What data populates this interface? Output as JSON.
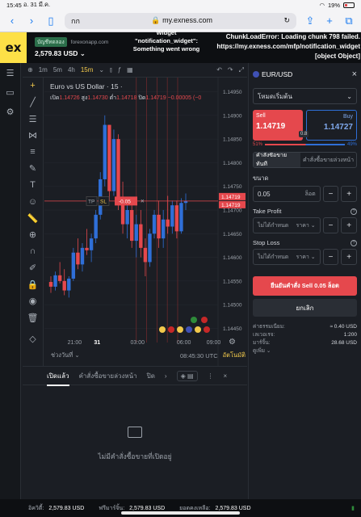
{
  "status": {
    "time": "15:45",
    "date": "อ. 31 มี.ค.",
    "battery": "19%"
  },
  "browser": {
    "back_icon": "chevron-left-icon",
    "forward_icon": "chevron-right-icon",
    "tab_text": "กก",
    "url": "my.exness.com"
  },
  "header": {
    "account_badge": "บัญชีทดลอง",
    "account_host": "forexonapp.com",
    "balance": "2,579.83 USD",
    "error_widget": "Widget \"notification_widget\": Something went wrong",
    "error_chunk": "ChunkLoadError: Loading chunk 798 failed. https://my.exness.com/mfp/notification_widget [object Object]"
  },
  "toolbar": {
    "timeframes": [
      "1m",
      "5m",
      "4h",
      "15m"
    ],
    "active_timeframe": "15m"
  },
  "chart_data": {
    "type": "candlestick",
    "title": "Euro vs US Dollar · 15 ·",
    "ohlc_label": {
      "o": "1.14726",
      "h": "1.14730",
      "l": "1.14718",
      "c": "1.14719",
      "chg": "−0.00005 (−0"
    },
    "labels_prefix": {
      "o": "เปิด",
      "h": "สูง",
      "l": "ต่ำ",
      "c": "ปิด"
    },
    "y_ticks": [
      "1.14950",
      "1.14900",
      "1.14850",
      "1.14800",
      "1.14750",
      "1.14700",
      "1.14650",
      "1.14600",
      "1.14550",
      "1.14500",
      "1.14450"
    ],
    "y_range": [
      1.1442,
      1.1498
    ],
    "x_ticks": [
      "21:00",
      "31",
      "03:00",
      "06:00",
      "09:00"
    ],
    "price_label": "1.14719",
    "price_label2": "1.14719",
    "position_bar": {
      "tp": "TP",
      "sl": "SL",
      "pnl": "-0.05"
    },
    "candles": [
      [
        1.14548,
        1.1456,
        1.14525,
        1.14538
      ],
      [
        1.14538,
        1.1457,
        1.1453,
        1.14562
      ],
      [
        1.14562,
        1.1459,
        1.14545,
        1.1455
      ],
      [
        1.1455,
        1.14575,
        1.1452,
        1.1453
      ],
      [
        1.1453,
        1.1456,
        1.14515,
        1.14555
      ],
      [
        1.14555,
        1.1462,
        1.1455,
        1.1461
      ],
      [
        1.1461,
        1.1464,
        1.14575,
        1.14585
      ],
      [
        1.14585,
        1.1463,
        1.1457,
        1.1462
      ],
      [
        1.1462,
        1.1466,
        1.14605,
        1.14615
      ],
      [
        1.14615,
        1.1465,
        1.1459,
        1.1464
      ],
      [
        1.1464,
        1.147,
        1.1463,
        1.1469
      ],
      [
        1.1469,
        1.1478,
        1.1468,
        1.14765
      ],
      [
        1.14765,
        1.149,
        1.1475,
        1.1488
      ],
      [
        1.1488,
        1.1488,
        1.1472,
        1.1474
      ],
      [
        1.1474,
        1.1487,
        1.1473,
        1.1485
      ],
      [
        1.1485,
        1.1486,
        1.147,
        1.1472
      ],
      [
        1.1472,
        1.1476,
        1.1465,
        1.1467
      ],
      [
        1.1467,
        1.1472,
        1.1464,
        1.147
      ],
      [
        1.147,
        1.1471,
        1.1462,
        1.14635
      ],
      [
        1.14635,
        1.1469,
        1.146,
        1.1467
      ],
      [
        1.1467,
        1.147,
        1.146,
        1.1462
      ],
      [
        1.1462,
        1.1464,
        1.1456,
        1.1459
      ],
      [
        1.1459,
        1.1466,
        1.1458,
        1.1465
      ],
      [
        1.1465,
        1.147,
        1.1464,
        1.1469
      ],
      [
        1.1469,
        1.1472,
        1.1462,
        1.1464
      ],
      [
        1.1464,
        1.147,
        1.1462,
        1.1468
      ],
      [
        1.1468,
        1.1473,
        1.1465,
        1.14665
      ],
      [
        1.14665,
        1.1472,
        1.1465,
        1.1471
      ],
      [
        1.1471,
        1.1472,
        1.1464,
        1.14655
      ],
      [
        1.14655,
        1.14725,
        1.1465,
        1.14715
      ],
      [
        1.14715,
        1.14735,
        1.147,
        1.14719
      ]
    ]
  },
  "range_bar": {
    "range_label": "ช่วงวันที่",
    "time": "08:45:30 UTC",
    "auto": "อัตโนมัติ"
  },
  "orders": {
    "tabs": [
      "เปิดแล้ว",
      "คำสั่งซื้อขายล่วงหน้า",
      "ปิด"
    ],
    "empty_text": "ไม่มีคำสั่งซื้อขายที่เปิดอยู่"
  },
  "side": {
    "symbol": "EUR/USD",
    "mode": "โหมดเริ่มต้น",
    "sell_label": "Sell",
    "sell_price": "1.14719",
    "spread": "0.8",
    "buy_label": "Buy",
    "buy_price": "1.14727",
    "pct_sell": "51%",
    "pct_buy": "49%",
    "order_tab_market": "คำสั่งซื้อขายทันที",
    "order_tab_pending": "คำสั่งซื้อขายล่วงหน้า",
    "volume_label": "ขนาด",
    "volume": "0.05",
    "volume_unit": "ล็อต",
    "tp_label": "Take Profit",
    "tp_value": "ไม่ได้กำหนด",
    "tp_unit": "ราคา",
    "sl_label": "Stop Loss",
    "sl_value": "ไม่ได้กำหนด",
    "sl_unit": "ราคา",
    "confirm": "ยืนยันคำสั่ง Sell 0.05 ล็อต",
    "cancel": "ยกเลิก",
    "fee_label": "ค่าธรรมเนียม:",
    "fee_value": "≈ 0.40 USD",
    "leverage_label": "เลเวอเรจ:",
    "leverage_value": "1:200",
    "margin_label": "มาร์จิ้น:",
    "margin_value": "28.68 USD",
    "more": "ดูเพิ่ม"
  },
  "footer": {
    "equity_label": "อิควิตี้:",
    "equity": "2,579.83 USD",
    "free_margin_label": "ฟรีมาร์จิ้น:",
    "free_margin": "2,579.83 USD",
    "balance_label": "ยอดคงเหลือ:",
    "balance": "2,579.83 USD"
  },
  "colors": {
    "bull": "#2f6fd8",
    "bear": "#e5484d",
    "accent": "#f2c94c"
  }
}
